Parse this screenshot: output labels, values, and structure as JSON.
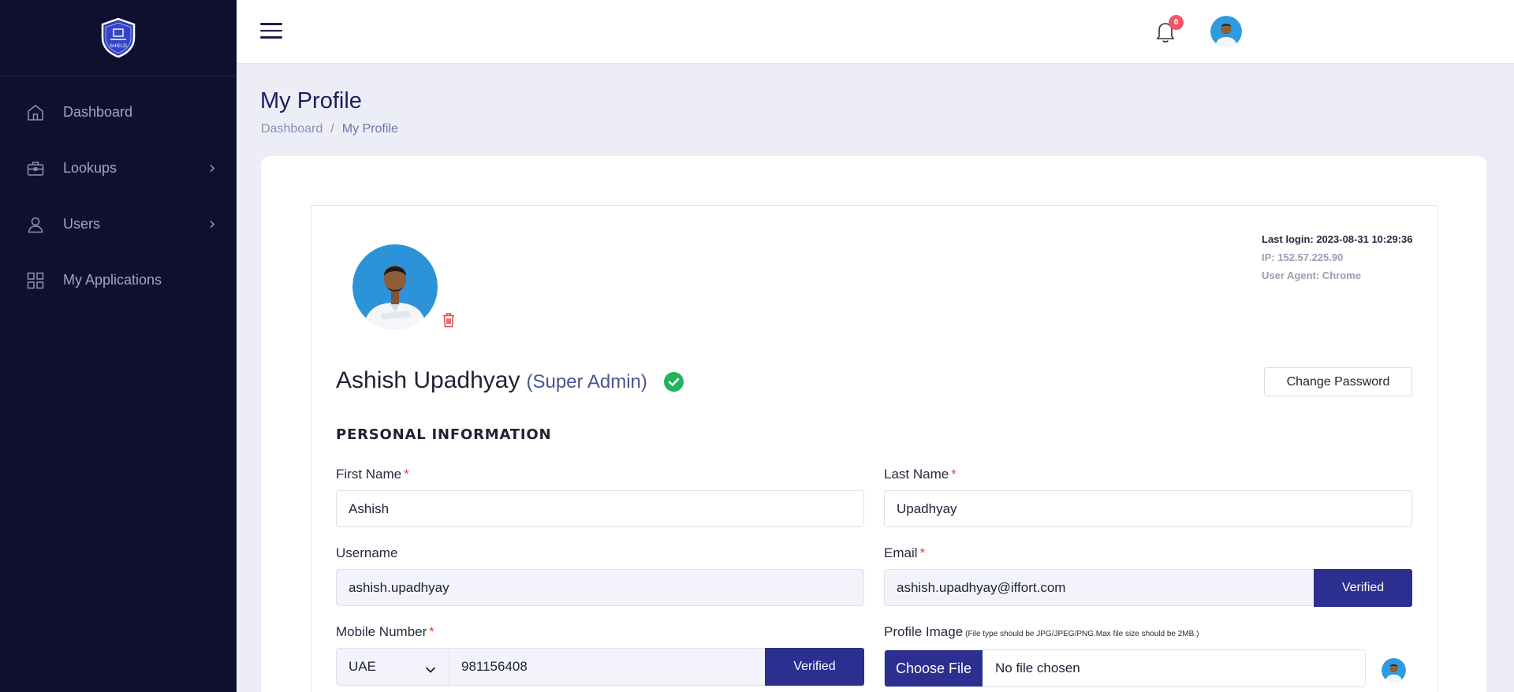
{
  "brand": {
    "logo_text": "SHIELD"
  },
  "sidebar": {
    "items": [
      {
        "label": "Dashboard",
        "icon": "home-icon"
      },
      {
        "label": "Lookups",
        "icon": "briefcase-icon"
      },
      {
        "label": "Users",
        "icon": "user-icon"
      },
      {
        "label": "My Applications",
        "icon": "grid-icon"
      }
    ]
  },
  "topbar": {
    "notification_count": "0"
  },
  "page": {
    "title": "My Profile",
    "breadcrumb": {
      "home": "Dashboard",
      "separator": "/",
      "current": "My Profile"
    }
  },
  "profile": {
    "last_login": "Last login: 2023-08-31 10:29:36",
    "ip": "IP: 152.57.225.90",
    "user_agent": "User Agent: Chrome",
    "name": "Ashish Upadhyay",
    "role": "(Super Admin)",
    "change_password": "Change Password",
    "section_title": "PERSONAL INFORMATION"
  },
  "form": {
    "first_name": {
      "label": "First Name",
      "required": "*",
      "value": "Ashish"
    },
    "last_name": {
      "label": "Last Name",
      "required": "*",
      "value": "Upadhyay"
    },
    "username": {
      "label": "Username",
      "value": "ashish.upadhyay"
    },
    "email": {
      "label": "Email",
      "required": "*",
      "value": "ashish.upadhyay@iffort.com",
      "status": "Verified"
    },
    "mobile": {
      "label": "Mobile Number",
      "required": "*",
      "country": "UAE",
      "value": "981156408",
      "status": "Verified"
    },
    "profile_image": {
      "label": "Profile Image",
      "hint": "(File type should be JPG/JPEG/PNG.Max file size should be 2MB.)",
      "button": "Choose File",
      "status": "No file chosen"
    }
  },
  "colors": {
    "sidebar": "#0f1030",
    "accent": "#2b2f8f",
    "page_bg": "#ecedf7",
    "success": "#22b35e",
    "danger": "#e2414f"
  }
}
